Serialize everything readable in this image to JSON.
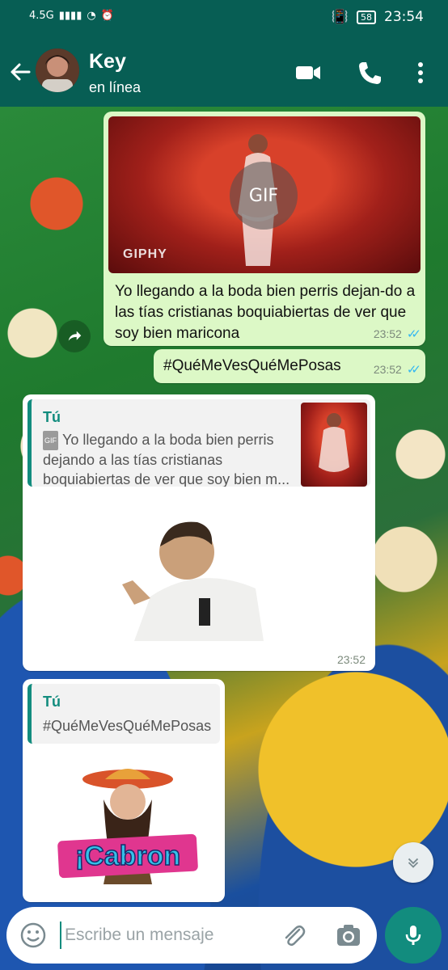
{
  "status_bar": {
    "network": "4.5G",
    "time": "23:54",
    "battery": "58"
  },
  "header": {
    "contact_name": "Key",
    "contact_status": "en línea",
    "icons": [
      "back-arrow-icon",
      "video-call-icon",
      "phone-icon",
      "more-icon"
    ]
  },
  "messages": [
    {
      "type": "gif",
      "direction": "out",
      "gif_badge": "GIF",
      "gif_source": "GIPHY",
      "text": "Yo llegando a la boda bien perris dejan-do a las tías cristianas boquiabiertas de ver que soy bien maricona",
      "time": "23:52",
      "ticks": "✓✓"
    },
    {
      "type": "text",
      "direction": "out",
      "text": "#QuéMeVesQuéMePosas",
      "time": "23:52",
      "ticks": "✓✓"
    },
    {
      "type": "sticker-reply",
      "direction": "in",
      "quote_author": "Tú",
      "quote_tag": "GIF",
      "quote_text": "Yo llegando a la boda bien perris dejando a las tías cristianas boquiabiertas de ver que soy bien m...",
      "time": "23:52"
    },
    {
      "type": "sticker-reply",
      "direction": "in",
      "quote_author": "Tú",
      "quote_text": "#QuéMeVesQuéMePosas",
      "sticker_text": "¡Cabron"
    }
  ],
  "composer": {
    "placeholder": "Escribe un mensaje"
  },
  "colors": {
    "header": "#075e54",
    "outgoing_bubble": "#dcf8c6",
    "accent": "#128c7e",
    "read_ticks": "#34b7f1"
  }
}
